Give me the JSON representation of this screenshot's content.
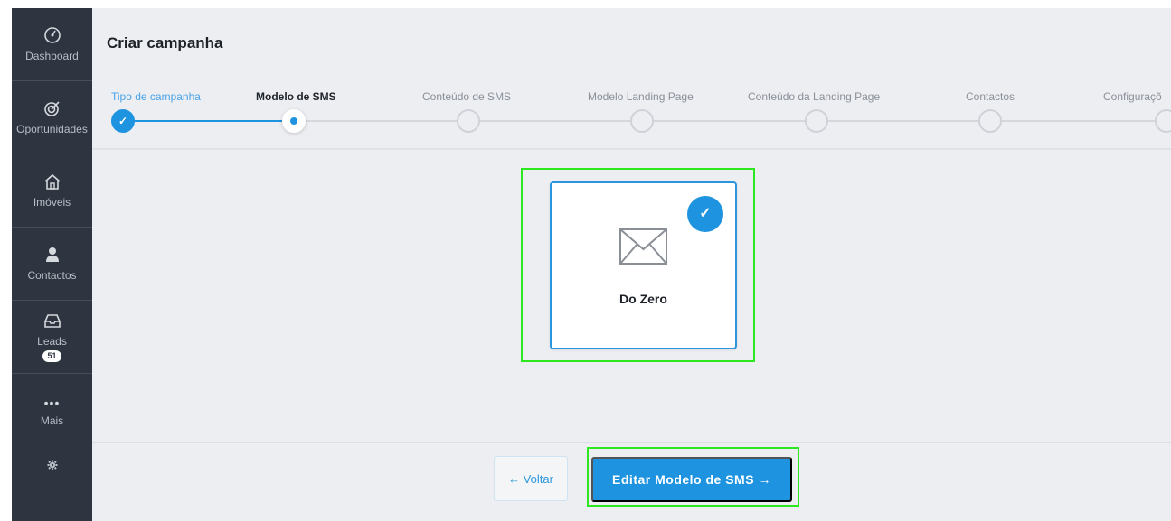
{
  "sidebar": {
    "items": [
      {
        "label": "Dashboard",
        "icon": "dashboard-icon"
      },
      {
        "label": "Oportunidades",
        "icon": "target-icon"
      },
      {
        "label": "Imóveis",
        "icon": "house-icon"
      },
      {
        "label": "Contactos",
        "icon": "person-icon"
      },
      {
        "label": "Leads",
        "icon": "inbox-icon",
        "badge": "51"
      },
      {
        "label": "Mais",
        "icon": "more-icon"
      }
    ],
    "settings_icon": "gear-icon"
  },
  "page": {
    "title": "Criar campanha"
  },
  "steps": [
    {
      "label": "Tipo de campanha",
      "state": "done"
    },
    {
      "label": "Modelo de SMS",
      "state": "current"
    },
    {
      "label": "Conteúdo de SMS",
      "state": "pending"
    },
    {
      "label": "Modelo Landing Page",
      "state": "pending"
    },
    {
      "label": "Conteúdo da Landing Page",
      "state": "pending"
    },
    {
      "label": "Contactos",
      "state": "pending"
    },
    {
      "label": "Configuraçõ",
      "state": "pending"
    }
  ],
  "template_card": {
    "title": "Do Zero",
    "selected": true,
    "icon": "envelope-icon"
  },
  "footer": {
    "back_label": "← Voltar",
    "next_label": "Editar Modelo de SMS →"
  },
  "colors": {
    "accent": "#1e93e0",
    "sidebar_bg": "#2e3440",
    "highlight": "#2ee81f"
  }
}
